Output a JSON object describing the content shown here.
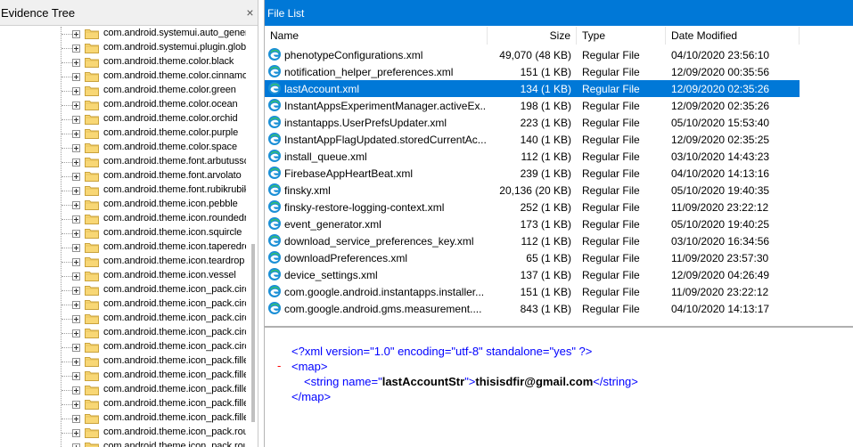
{
  "evidence_tree": {
    "title": "Evidence Tree",
    "close_symbol": "×",
    "items": [
      "com.android.systemui.auto_gener",
      "com.android.systemui.plugin.globa",
      "com.android.theme.color.black",
      "com.android.theme.color.cinnamo",
      "com.android.theme.color.green",
      "com.android.theme.color.ocean",
      "com.android.theme.color.orchid",
      "com.android.theme.color.purple",
      "com.android.theme.color.space",
      "com.android.theme.font.arbutusso",
      "com.android.theme.font.arvolato",
      "com.android.theme.font.rubikrubik",
      "com.android.theme.icon.pebble",
      "com.android.theme.icon.roundedr",
      "com.android.theme.icon.squircle",
      "com.android.theme.icon.taperedre",
      "com.android.theme.icon.teardrop",
      "com.android.theme.icon.vessel",
      "com.android.theme.icon_pack.circ",
      "com.android.theme.icon_pack.circ",
      "com.android.theme.icon_pack.circ",
      "com.android.theme.icon_pack.circ",
      "com.android.theme.icon_pack.circ",
      "com.android.theme.icon_pack.fille",
      "com.android.theme.icon_pack.fille",
      "com.android.theme.icon_pack.fille",
      "com.android.theme.icon_pack.fille",
      "com.android.theme.icon_pack.fille",
      "com.android.theme.icon_pack.rou",
      "com.android.theme.icon_pack.rou"
    ]
  },
  "file_list": {
    "title": "File List",
    "columns": {
      "name": "Name",
      "size": "Size",
      "type": "Type",
      "date": "Date Modified"
    },
    "selected_index": 2,
    "rows": [
      {
        "name": "phenotypeConfigurations.xml",
        "size": "49,070 (48 KB)",
        "type": "Regular File",
        "date": "04/10/2020 23:56:10"
      },
      {
        "name": "notification_helper_preferences.xml",
        "size": "151 (1 KB)",
        "type": "Regular File",
        "date": "12/09/2020 00:35:56"
      },
      {
        "name": "lastAccount.xml",
        "size": "134 (1 KB)",
        "type": "Regular File",
        "date": "12/09/2020 02:35:26"
      },
      {
        "name": "InstantAppsExperimentManager.activeEx...",
        "size": "198 (1 KB)",
        "type": "Regular File",
        "date": "12/09/2020 02:35:26"
      },
      {
        "name": "instantapps.UserPrefsUpdater.xml",
        "size": "223 (1 KB)",
        "type": "Regular File",
        "date": "05/10/2020 15:53:40"
      },
      {
        "name": "InstantAppFlagUpdated.storedCurrentAc...",
        "size": "140 (1 KB)",
        "type": "Regular File",
        "date": "12/09/2020 02:35:25"
      },
      {
        "name": "install_queue.xml",
        "size": "112 (1 KB)",
        "type": "Regular File",
        "date": "03/10/2020 14:43:23"
      },
      {
        "name": "FirebaseAppHeartBeat.xml",
        "size": "239 (1 KB)",
        "type": "Regular File",
        "date": "04/10/2020 14:13:16"
      },
      {
        "name": "finsky.xml",
        "size": "20,136 (20 KB)",
        "type": "Regular File",
        "date": "05/10/2020 19:40:35"
      },
      {
        "name": "finsky-restore-logging-context.xml",
        "size": "252 (1 KB)",
        "type": "Regular File",
        "date": "11/09/2020 23:22:12"
      },
      {
        "name": "event_generator.xml",
        "size": "173 (1 KB)",
        "type": "Regular File",
        "date": "05/10/2020 19:40:25"
      },
      {
        "name": "download_service_preferences_key.xml",
        "size": "112 (1 KB)",
        "type": "Regular File",
        "date": "03/10/2020 16:34:56"
      },
      {
        "name": "downloadPreferences.xml",
        "size": "65 (1 KB)",
        "type": "Regular File",
        "date": "11/09/2020 23:57:30"
      },
      {
        "name": "device_settings.xml",
        "size": "137 (1 KB)",
        "type": "Regular File",
        "date": "12/09/2020 04:26:49"
      },
      {
        "name": "com.google.android.instantapps.installer...",
        "size": "151 (1 KB)",
        "type": "Regular File",
        "date": "11/09/2020 23:22:12"
      },
      {
        "name": "com.google.android.gms.measurement....",
        "size": "843 (1 KB)",
        "type": "Regular File",
        "date": "04/10/2020 14:13:17"
      }
    ]
  },
  "xml_viewer": {
    "declaration": "<?xml version=\"1.0\" encoding=\"utf-8\" standalone=\"yes\" ?>",
    "collapse_symbol": "-",
    "map_open": "<map>",
    "string_open_prefix": "<string name=\"",
    "string_attr_value": "lastAccountStr",
    "string_open_suffix": "\">",
    "string_value": "thisisdfir@gmail.com",
    "string_close": "</string>",
    "map_close": "</map>"
  },
  "colors": {
    "accent": "#0078d7",
    "xml_tag": "#0000ff",
    "xml_attr": "#990000",
    "xml_collapse": "#ff0000"
  },
  "icons": {
    "tree_folder": "folder-icon",
    "tree_expander": "plus-expander-icon",
    "file": "edge-browser-file-icon"
  }
}
